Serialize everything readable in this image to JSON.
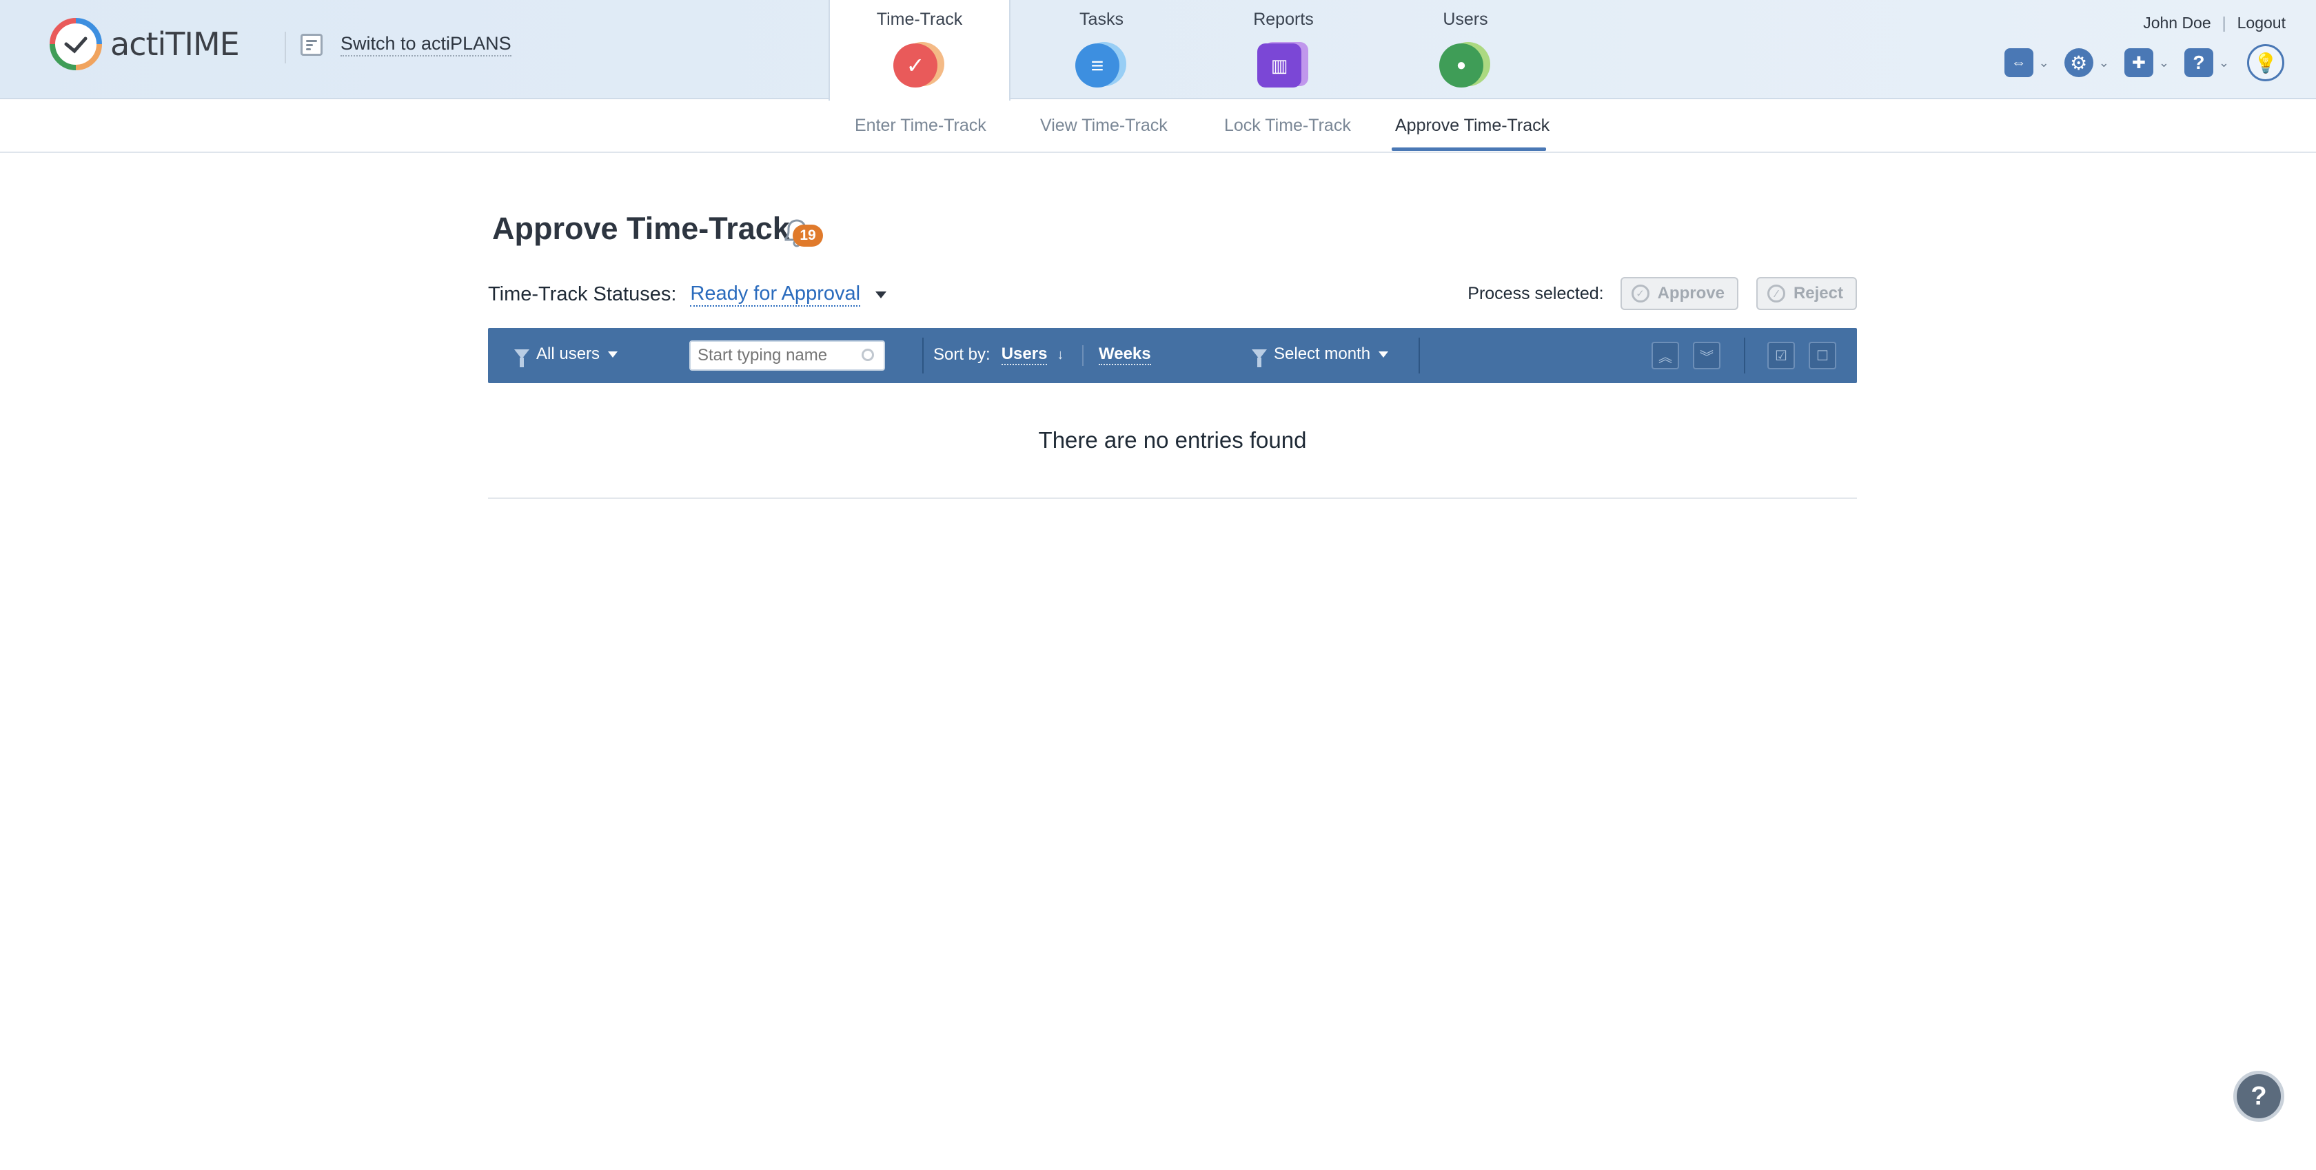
{
  "app": {
    "logo_text": "actiTIME",
    "switch_label": "Switch to actiPLANS"
  },
  "nav": [
    {
      "label": "Time-Track",
      "icon": "time-track-check-icon",
      "color": "#e95a5a",
      "color2": "#f0a35e",
      "glyph": "✓",
      "active": true
    },
    {
      "label": "Tasks",
      "icon": "tasks-list-icon",
      "color": "#3d8fe0",
      "color2": "#7fc4f4",
      "glyph": "≡",
      "active": false
    },
    {
      "label": "Reports",
      "icon": "reports-chart-icon",
      "color": "#7b47d6",
      "color2": "#b47ae8",
      "glyph": "▥",
      "active": false
    },
    {
      "label": "Users",
      "icon": "users-person-icon",
      "color": "#3f9d57",
      "color2": "#9ad25a",
      "glyph": "●",
      "active": false
    }
  ],
  "user": {
    "name": "John Doe",
    "logout": "Logout"
  },
  "subnav": [
    {
      "label": "Enter Time-Track",
      "active": false
    },
    {
      "label": "View Time-Track",
      "active": false
    },
    {
      "label": "Lock Time-Track",
      "active": false
    },
    {
      "label": "Approve Time-Track",
      "active": true
    }
  ],
  "page": {
    "title": "Approve Time-Track",
    "notification_count": "19"
  },
  "status": {
    "label": "Time-Track Statuses:",
    "value": "Ready for Approval"
  },
  "process": {
    "label": "Process selected:",
    "approve": "Approve",
    "reject": "Reject"
  },
  "toolbar": {
    "users_filter": "All users",
    "search_placeholder": "Start typing name",
    "sort_label": "Sort by:",
    "sort_value": "Users",
    "weeks": "Weeks",
    "month_filter": "Select month"
  },
  "empty_message": "There are no entries found",
  "colors": {
    "accent": "#4470a3",
    "link": "#2a6bbd",
    "badge": "#e07a2b"
  }
}
